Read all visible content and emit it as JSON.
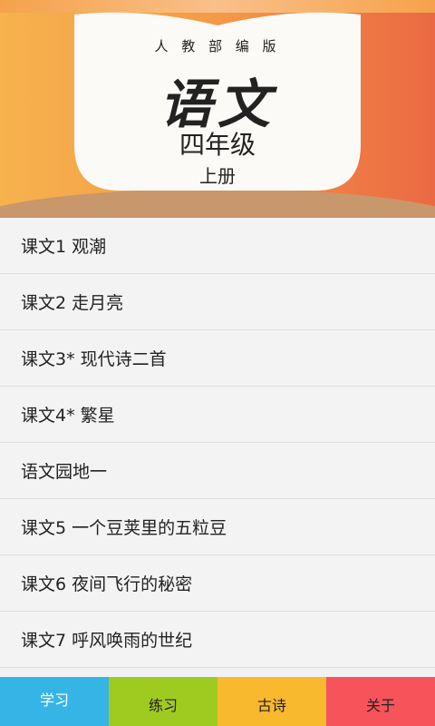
{
  "header": {
    "publisher": "人 教 部 编 版",
    "subject": "语文",
    "grade": "四年级",
    "volume": "上册"
  },
  "lessons": [
    "课文1 观潮",
    "课文2 走月亮",
    "课文3* 现代诗二首",
    "课文4* 繁星",
    "语文园地一",
    "课文5 一个豆荚里的五粒豆",
    "课文6 夜间飞行的秘密",
    "课文7 呼风唤雨的世纪"
  ],
  "tabs": [
    "学习",
    "练习",
    "古诗",
    "关于"
  ],
  "colors": {
    "tab_study": "#35b5e6",
    "tab_practice": "#9fcb21",
    "tab_poems": "#f8b92f",
    "tab_about": "#f7535a"
  }
}
